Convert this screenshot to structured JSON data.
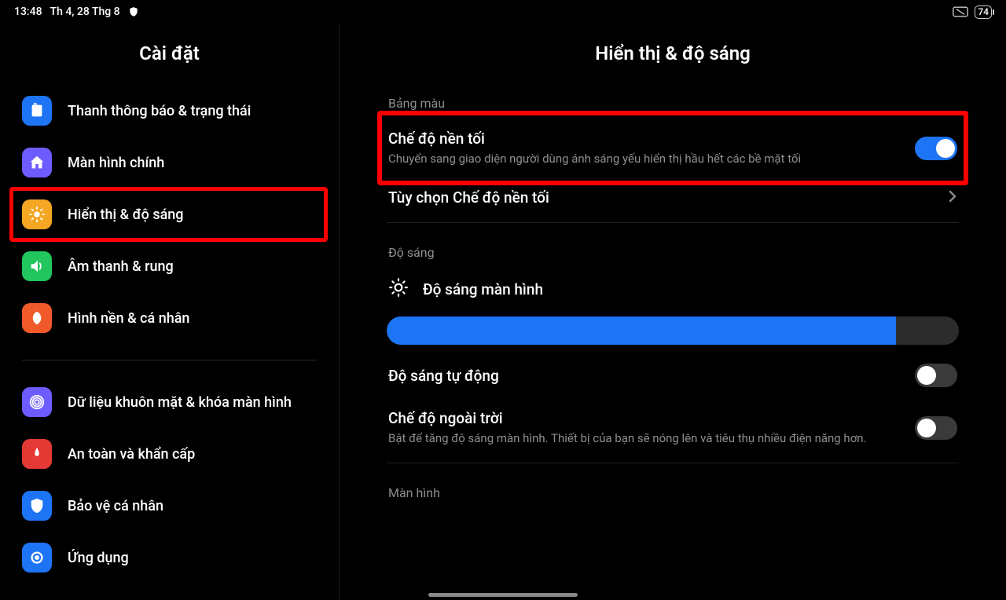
{
  "status": {
    "time": "13:48",
    "date": "Th 4, 28 Thg 8",
    "battery": "74"
  },
  "sidebar": {
    "title": "Cài đặt",
    "items": [
      {
        "label": "Thanh thông báo & trạng thái",
        "color": "#1d74f5"
      },
      {
        "label": "Màn hình chính",
        "color": "#6d5cff"
      },
      {
        "label": "Hiển thị & độ sáng",
        "color": "#f5a623"
      },
      {
        "label": "Âm thanh & rung",
        "color": "#22c55e"
      },
      {
        "label": "Hình nền & cá nhân",
        "color": "#f05a2a"
      },
      {
        "label": "Dữ liệu khuôn mặt & khóa màn hình",
        "color": "#6d5cff"
      },
      {
        "label": "An toàn và khẩn cấp",
        "color": "#e53935"
      },
      {
        "label": "Bảo vệ cá nhân",
        "color": "#1d74f5"
      },
      {
        "label": "Ứng dụng",
        "color": "#1d74f5"
      }
    ]
  },
  "content": {
    "title": "Hiển thị & độ sáng",
    "sec_color": "Bảng màu",
    "dark_mode": {
      "title": "Chế độ nền tối",
      "sub": "Chuyển sang giao diện người dùng ánh sáng yếu hiển thị hầu hết các bề mặt tối"
    },
    "dark_options": "Tùy chọn Chế độ nền tối",
    "sec_brightness": "Độ sáng",
    "brightness_label": "Độ sáng màn hình",
    "brightness_percent": 89,
    "auto_brightness": "Độ sáng tự động",
    "outdoor": {
      "title": "Chế độ ngoài trời",
      "sub": "Bật để tăng độ sáng màn hình. Thiết bị của bạn sẽ nóng lên và tiêu thụ nhiều điện năng hơn."
    },
    "sec_screen": "Màn hình"
  }
}
